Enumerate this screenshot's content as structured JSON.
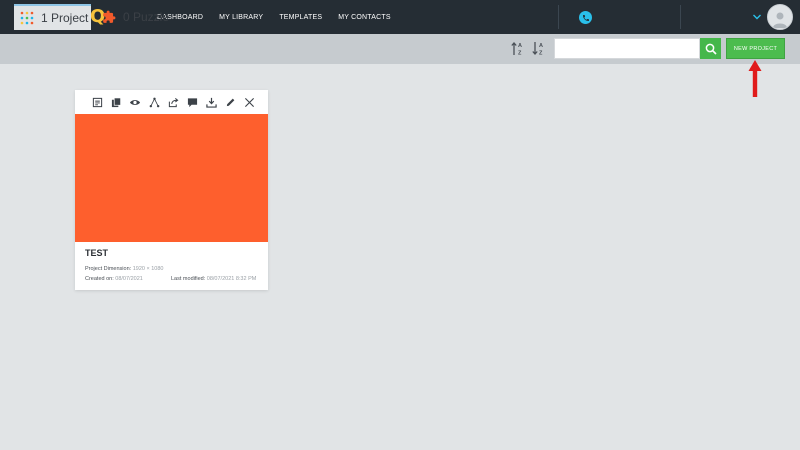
{
  "app": {
    "logo_first": "L",
    "logo_rest": "ESLINQ",
    "brand_color": "#1fb6e8",
    "accent_color": "#f7c33b"
  },
  "nav": {
    "items": [
      {
        "label": "DASHBOARD"
      },
      {
        "label": "MY LIBRARY"
      },
      {
        "label": "TEMPLATES"
      },
      {
        "label": "MY CONTACTS"
      }
    ]
  },
  "header_icons": {
    "phone": "phone-icon",
    "dropdown": "chevron-down-icon",
    "avatar": "user-avatar"
  },
  "toolbar": {
    "tabs": [
      {
        "label": "1 Project",
        "icon": "grid-icon",
        "active": true
      },
      {
        "label": "0 Puzzle",
        "icon": "puzzle-icon",
        "active": false
      }
    ],
    "sort_asc_icon": "sort-az-icon",
    "sort_desc_icon": "sort-za-icon",
    "search": {
      "value": "",
      "placeholder": ""
    },
    "new_project_label": "NEW PROJECT"
  },
  "card": {
    "title": "TEST",
    "thumbnail_color": "#fe5f2d",
    "dimension_label": "Project Dimension:",
    "dimension_value": "1920 × 1080",
    "created_label": "Created on:",
    "created_value": "08/07/2021",
    "modified_label": "Last modified:",
    "modified_value": "08/07/2021 8:32 PM",
    "actions": [
      "copy-link-icon",
      "duplicate-icon",
      "preview-icon",
      "share-network-icon",
      "export-icon",
      "comment-icon",
      "download-icon",
      "edit-icon",
      "close-icon"
    ]
  }
}
